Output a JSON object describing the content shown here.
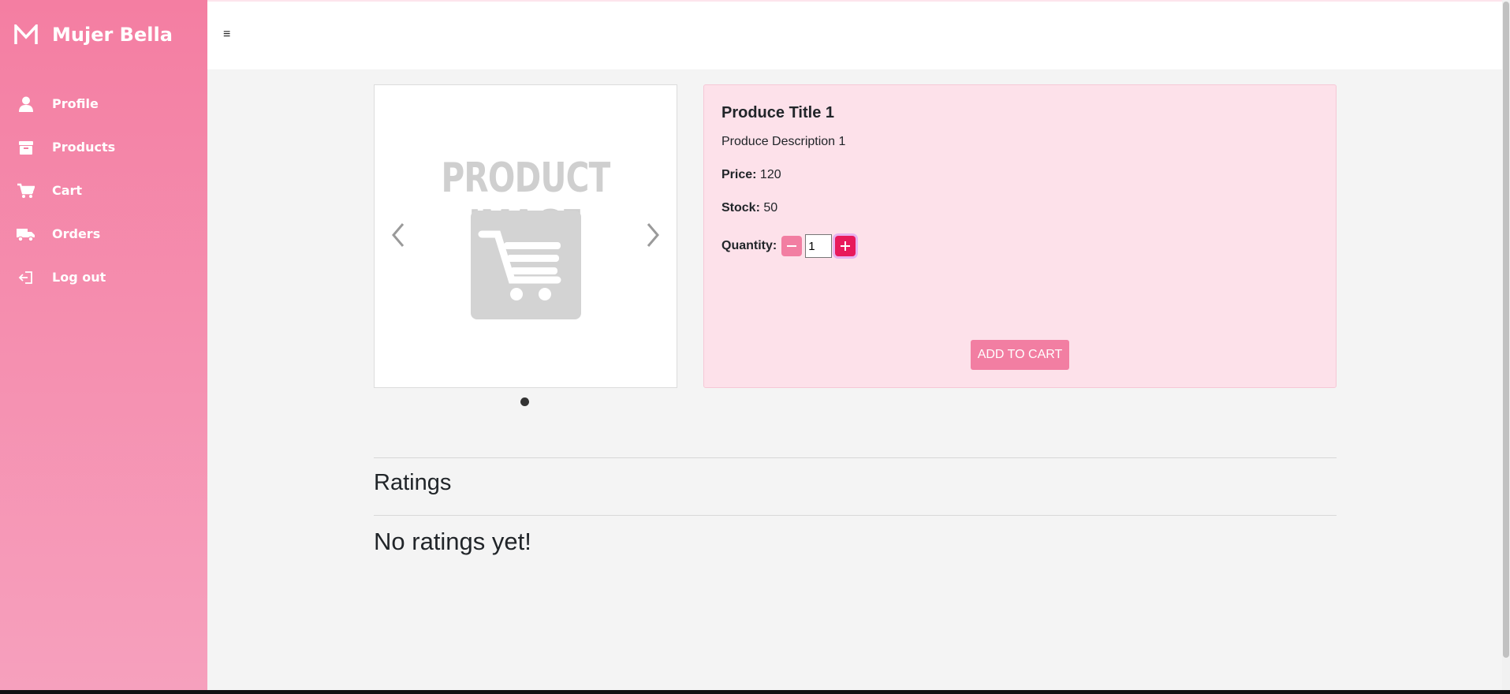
{
  "brand": {
    "name": "Mujer Bella",
    "logo_icon": "m-logo-icon"
  },
  "sidebar": {
    "items": [
      {
        "label": "Profile",
        "icon": "user-icon"
      },
      {
        "label": "Products",
        "icon": "box-icon"
      },
      {
        "label": "Cart",
        "icon": "cart-icon"
      },
      {
        "label": "Orders",
        "icon": "truck-icon"
      },
      {
        "label": "Log out",
        "icon": "logout-icon"
      }
    ]
  },
  "topbar": {
    "menu_icon": "≡"
  },
  "product": {
    "image_placeholder_text": "PRODUCT IMAGE",
    "title": "Produce Title 1",
    "description": "Produce Description 1",
    "price_label": "Price:",
    "price": "120",
    "stock_label": "Stock:",
    "stock": "50",
    "quantity_label": "Quantity:",
    "quantity": "1",
    "add_to_cart_label": "ADD TO CART"
  },
  "ratings": {
    "heading": "Ratings",
    "empty_text": "No ratings yet!"
  },
  "colors": {
    "sidebar_top": "#f47ea2",
    "sidebar_bottom": "#f6a0bd",
    "card_bg": "#fde1ea",
    "accent": "#e8195b",
    "button": "#f27ea2"
  }
}
